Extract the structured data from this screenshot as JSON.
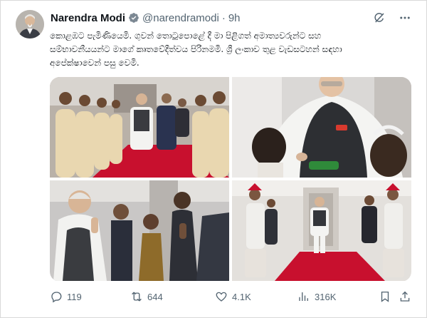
{
  "author": {
    "name": "Narendra Modi",
    "handle": "@narendramodi",
    "separator": "·",
    "time": "9h"
  },
  "tweet": {
    "line1": "කොළඹට පැමිණියෙමි. ගුවන් තොටුපොළේ දී මා පිළිගත් අමාත්‍යවරුන්ට සහ",
    "line2": "සම්භාවනීයයන්ට මාගේ කෘතවේදීත්වය පිරිනමමි. ශ්‍රී ලංකාව තුළ වැඩසටහන් සඳහා",
    "line3": "අපේක්ෂාවෙන් පසු වෙමි."
  },
  "actions": {
    "replies": "119",
    "reposts": "644",
    "likes": "4.1K",
    "views": "316K"
  },
  "icons": {
    "verified": "verified-badge-icon",
    "grok": "grok-icon",
    "more": "more-icon",
    "reply": "reply-icon",
    "repost": "repost-icon",
    "like": "heart-icon",
    "views": "views-icon",
    "bookmark": "bookmark-icon",
    "share": "share-icon"
  },
  "colors": {
    "verified": "#1d9bf0",
    "text": "#0f1419",
    "secondary": "#536471",
    "carpet": "#c8102e"
  }
}
